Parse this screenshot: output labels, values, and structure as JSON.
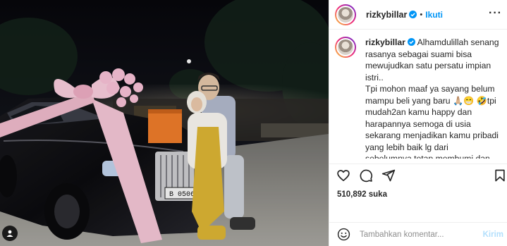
{
  "post": {
    "username": "rizkybillar",
    "dot": "•",
    "follow_label": "Ikuti",
    "more_icon": "more-horizontal-icon",
    "caption": "Alhamdulillah senang rasanya sebagai suami bisa mewujudkan satu persatu impian istri..\nTpi mohon maaf ya sayang belum mampu beli yang baru 🙏🏼😁 🤣tpi mudah2an kamu happy dan harapannya semoga di usia sekarang menjadikan kamu pribadi yang lebih baik lg dari sebelumnya,tetap membumi dan selalu ingat dari mana kamu berasal dan terakhir tetap selalu",
    "likes": "510,892 suka",
    "comment_placeholder": "Tambahkan komentar...",
    "post_label": "Kirim",
    "plate": "B 0506"
  },
  "colors": {
    "accent": "#0095f6",
    "post_disabled": "#b2dffc",
    "text": "#262626",
    "muted": "#8e8e8e",
    "divider": "#efefef"
  },
  "icons": [
    "verified-badge-icon",
    "heart-icon",
    "comment-icon",
    "share-icon",
    "bookmark-icon",
    "emoji-icon",
    "user-tag-icon"
  ]
}
